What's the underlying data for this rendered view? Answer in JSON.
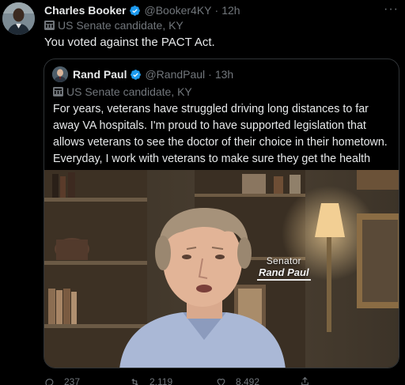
{
  "tweet": {
    "author_name": "Charles Booker",
    "handle": "@Booker4KY",
    "dot": "·",
    "time": "12h",
    "label": "US Senate candidate, KY",
    "text": "You voted against the PACT Act.",
    "more": "···"
  },
  "quoted": {
    "author_name": "Rand Paul",
    "handle": "@RandPaul",
    "dot": "·",
    "time": "13h",
    "label": "US Senate candidate, KY",
    "text": "For years, veterans have struggled driving long distances to far away VA hospitals. I'm proud to have supported legislation that allows veterans to see the doctor of their choice in their hometown. Everyday, I work with veterans to make sure they get the health care they deserve.",
    "video_caption_title": "Senator",
    "video_caption_name": "Rand Paul"
  },
  "actions": {
    "replies": "237",
    "retweets": "2,119",
    "likes": "8,492"
  },
  "colors": {
    "background": "#000000",
    "text_primary": "#e7e9ea",
    "text_secondary": "#71767b",
    "verified_badge": "#1d9bf0",
    "border": "#2f3336"
  },
  "icons": [
    "verified-badge-icon",
    "government-label-icon",
    "more-icon",
    "reply-icon",
    "retweet-icon",
    "like-icon",
    "share-icon"
  ]
}
